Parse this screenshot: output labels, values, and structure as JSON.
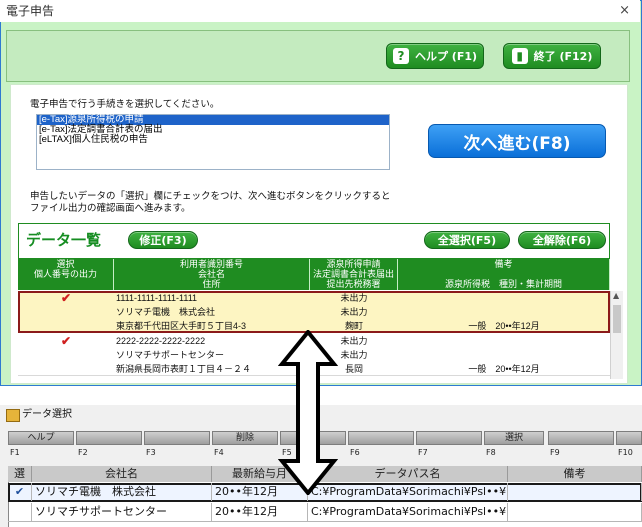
{
  "window": {
    "title": "電子申告",
    "close_glyph": "×"
  },
  "toolbar": {
    "help_label": "ヘルプ (F1)",
    "exit_label": "終了 (F12)"
  },
  "instruction1": "電子申告で行う手続きを選択してください。",
  "procedures": [
    "[e-Tax]源泉所得税の申請",
    "[e-Tax]法定調書合計表の届出",
    "[eLTAX]個人住民税の申告"
  ],
  "next_button": "次へ進む(F8)",
  "instruction2_line1": "申告したいデータの「選択」欄にチェックをつけ、次へ進むボタンをクリックすると",
  "instruction2_line2": "ファイル出力の確認画面へ進みます。",
  "data_list": {
    "title": "データ一覧",
    "modify_button": "修正(F3)",
    "select_all_button": "全選択(F5)",
    "clear_all_button": "全解除(F6)",
    "headers": {
      "col1_line1": "選択",
      "col1_line2": "個人番号の出力",
      "col2_line1": "利用者識別番号",
      "col2_line2": "会社名",
      "col2_line3": "住所",
      "col3_line1": "源泉所得申請",
      "col3_line2": "法定調書合計表届出",
      "col3_line3": "提出先税務署",
      "col4_line1": "備考",
      "col4_line3": "源泉所得税　種別・集計期間"
    },
    "records": [
      {
        "checked": true,
        "id": "1111-1111-1111-1111",
        "company": "ソリマチ電機　株式会社",
        "address": "東京都千代田区大手町５丁目4-3",
        "status1": "未出力",
        "status2": "未出力",
        "office": "麹町",
        "note": "一般　20••年12月"
      },
      {
        "checked": true,
        "id": "2222-2222-2222-2222",
        "company": "ソリマチサポートセンター",
        "address": "新潟県長岡市表町１丁目４－２４",
        "status1": "未出力",
        "status2": "未出力",
        "office": "長岡",
        "note": "一般　20••年12月"
      }
    ]
  },
  "dialog": {
    "title": "データ選択",
    "fkeys": [
      {
        "key": "F1",
        "label": "ヘルプ"
      },
      {
        "key": "F2",
        "label": ""
      },
      {
        "key": "F3",
        "label": ""
      },
      {
        "key": "F4",
        "label": "削除"
      },
      {
        "key": "F5",
        "label": ""
      },
      {
        "key": "F6",
        "label": ""
      },
      {
        "key": "F7",
        "label": ""
      },
      {
        "key": "F8",
        "label": "選択"
      },
      {
        "key": "F9",
        "label": ""
      },
      {
        "key": "F10",
        "label": ""
      }
    ],
    "headers": {
      "select": "選",
      "company": "会社名",
      "latest": "最新給与月",
      "path": "データパス名",
      "note": "備考"
    },
    "rows": [
      {
        "check": "✔",
        "company": "ソリマチ電機　株式会社",
        "month": "20••年12月",
        "path": "C:¥ProgramData¥Sorimachi¥Psl••¥",
        "note": ""
      },
      {
        "check": "",
        "company": "ソリマチサポートセンター",
        "month": "20••年12月",
        "path": "C:¥ProgramData¥Sorimachi¥Psl••¥",
        "note": ""
      }
    ]
  },
  "colors": {
    "accent_green": "#1f8c21",
    "window_bg": "#c9f3c5",
    "highlight_row": "#fdf5c2",
    "highlight_border": "#8b1a1a",
    "next_blue": "#0a6fd8",
    "check_red": "#d02020"
  }
}
